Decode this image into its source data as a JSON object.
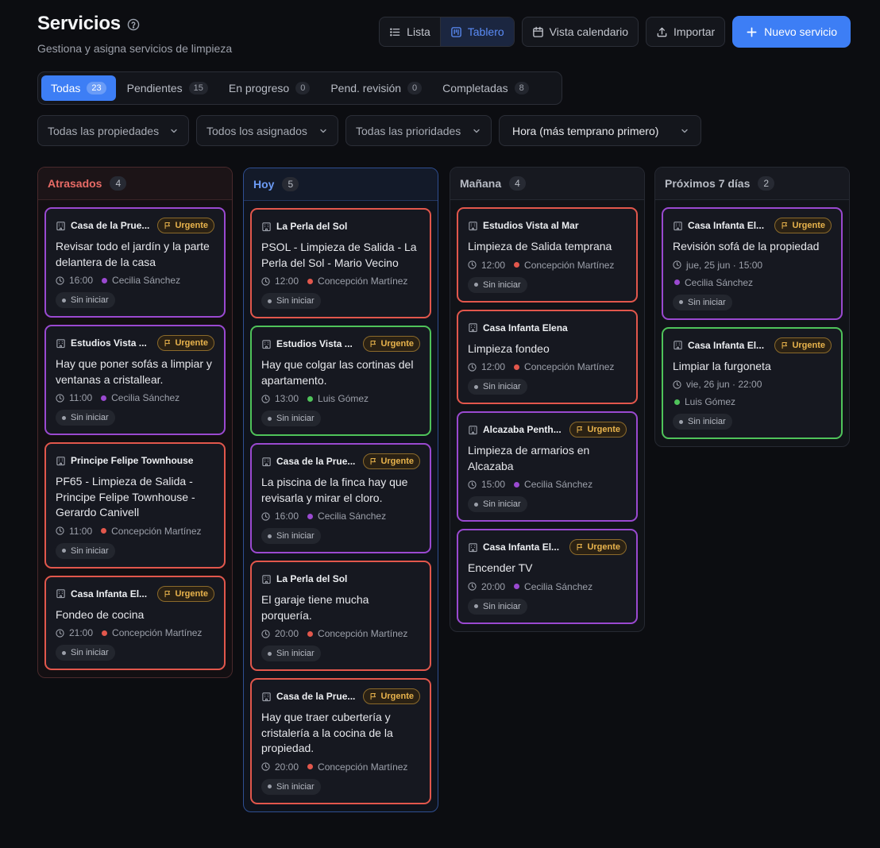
{
  "header": {
    "title": "Servicios",
    "subtitle": "Gestiona y asigna servicios de limpieza"
  },
  "toolbar": {
    "view_list": "Lista",
    "view_board": "Tablero",
    "calendar": "Vista calendario",
    "import": "Importar",
    "new_service": "Nuevo servicio"
  },
  "tabs": [
    {
      "label": "Todas",
      "count": "23"
    },
    {
      "label": "Pendientes",
      "count": "15"
    },
    {
      "label": "En progreso",
      "count": "0"
    },
    {
      "label": "Pend. revisión",
      "count": "0"
    },
    {
      "label": "Completadas",
      "count": "8"
    }
  ],
  "filters": {
    "properties": "Todas las propiedades",
    "assignees": "Todos los asignados",
    "priorities": "Todas las prioridades",
    "sort": "Hora (más temprano primero)"
  },
  "colors": {
    "accent": "#3d7ef5",
    "purple": "#9a49d0",
    "red": "#e2574c",
    "green": "#4fc35a",
    "urgent": "#e8b34c"
  },
  "columns": [
    {
      "title": "Atrasados",
      "count": "4",
      "cards": [
        {
          "property": "Casa de la Prue...",
          "urgent": "Urgente",
          "desc": "Revisar todo el jardín y la parte delantera de la casa",
          "time": "16:00",
          "assignee": "Cecilia Sánchez",
          "status": "Sin iniciar"
        },
        {
          "property": "Estudios Vista ...",
          "urgent": "Urgente",
          "desc": "Hay que poner sofás a limpiar y ventanas a cristallear.",
          "time": "11:00",
          "assignee": "Cecilia Sánchez",
          "status": "Sin iniciar"
        },
        {
          "property": "Principe Felipe Townhouse",
          "desc": "PF65 - Limpieza de Salida - Principe Felipe Townhouse - Gerardo Canivell",
          "time": "11:00",
          "assignee": "Concepción Martínez",
          "status": "Sin iniciar"
        },
        {
          "property": "Casa Infanta El...",
          "urgent": "Urgente",
          "desc": "Fondeo de cocina",
          "time": "21:00",
          "assignee": "Concepción Martínez",
          "status": "Sin iniciar"
        }
      ]
    },
    {
      "title": "Hoy",
      "count": "5",
      "cards": [
        {
          "property": "La Perla del Sol",
          "desc": "PSOL - Limpieza de Salida - La Perla del Sol - Mario Vecino",
          "time": "12:00",
          "assignee": "Concepción Martínez",
          "status": "Sin iniciar"
        },
        {
          "property": "Estudios Vista ...",
          "urgent": "Urgente",
          "desc": "Hay que colgar las cortinas del apartamento.",
          "time": "13:00",
          "assignee": "Luis Gómez",
          "status": "Sin iniciar"
        },
        {
          "property": "Casa de la Prue...",
          "urgent": "Urgente",
          "desc": "La piscina de la finca hay que revisarla y mirar el cloro.",
          "time": "16:00",
          "assignee": "Cecilia Sánchez",
          "status": "Sin iniciar"
        },
        {
          "property": "La Perla del Sol",
          "desc": "El garaje tiene mucha porquería.",
          "time": "20:00",
          "assignee": "Concepción Martínez",
          "status": "Sin iniciar"
        },
        {
          "property": "Casa de la Prue...",
          "urgent": "Urgente",
          "desc": "Hay que traer cubertería y cristalería a la cocina de la propiedad.",
          "time": "20:00",
          "assignee": "Concepción Martínez",
          "status": "Sin iniciar"
        }
      ]
    },
    {
      "title": "Mañana",
      "count": "4",
      "cards": [
        {
          "property": "Estudios Vista al Mar",
          "desc": "Limpieza de Salida temprana",
          "time": "12:00",
          "assignee": "Concepción Martínez",
          "status": "Sin iniciar"
        },
        {
          "property": "Casa Infanta Elena",
          "desc": "Limpieza fondeo",
          "time": "12:00",
          "assignee": "Concepción Martínez",
          "status": "Sin iniciar"
        },
        {
          "property": "Alcazaba Penth...",
          "urgent": "Urgente",
          "desc": "Limpieza de armarios en Alcazaba",
          "time": "15:00",
          "assignee": "Cecilia Sánchez",
          "status": "Sin iniciar"
        },
        {
          "property": "Casa Infanta El...",
          "urgent": "Urgente",
          "desc": "Encender TV",
          "time": "20:00",
          "assignee": "Cecilia Sánchez",
          "status": "Sin iniciar"
        }
      ]
    },
    {
      "title": "Próximos 7 días",
      "count": "2",
      "cards": [
        {
          "property": "Casa Infanta El...",
          "urgent": "Urgente",
          "desc": "Revisión sofá de la propiedad",
          "time": "jue, 25 jun · 15:00",
          "assignee": "Cecilia Sánchez",
          "status": "Sin iniciar"
        },
        {
          "property": "Casa Infanta El...",
          "urgent": "Urgente",
          "desc": "Limpiar la furgoneta",
          "time": "vie, 26 jun · 22:00",
          "assignee": "Luis Gómez",
          "status": "Sin iniciar"
        }
      ]
    }
  ]
}
